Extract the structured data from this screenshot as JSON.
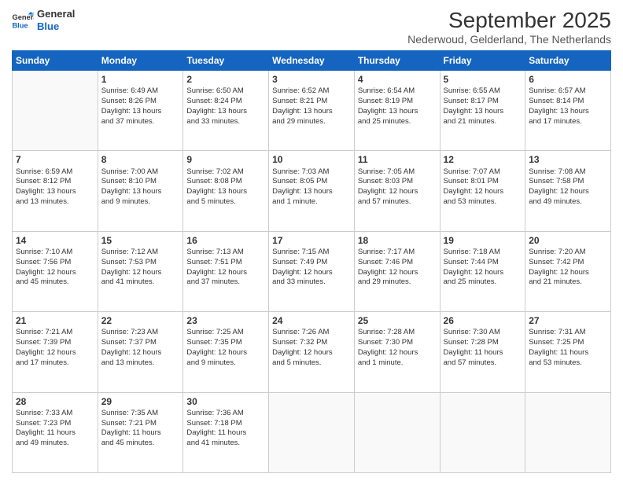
{
  "logo": {
    "line1": "General",
    "line2": "Blue"
  },
  "title": "September 2025",
  "subtitle": "Nederwoud, Gelderland, The Netherlands",
  "headers": [
    "Sunday",
    "Monday",
    "Tuesday",
    "Wednesday",
    "Thursday",
    "Friday",
    "Saturday"
  ],
  "weeks": [
    [
      {
        "day": "",
        "info": ""
      },
      {
        "day": "1",
        "info": "Sunrise: 6:49 AM\nSunset: 8:26 PM\nDaylight: 13 hours\nand 37 minutes."
      },
      {
        "day": "2",
        "info": "Sunrise: 6:50 AM\nSunset: 8:24 PM\nDaylight: 13 hours\nand 33 minutes."
      },
      {
        "day": "3",
        "info": "Sunrise: 6:52 AM\nSunset: 8:21 PM\nDaylight: 13 hours\nand 29 minutes."
      },
      {
        "day": "4",
        "info": "Sunrise: 6:54 AM\nSunset: 8:19 PM\nDaylight: 13 hours\nand 25 minutes."
      },
      {
        "day": "5",
        "info": "Sunrise: 6:55 AM\nSunset: 8:17 PM\nDaylight: 13 hours\nand 21 minutes."
      },
      {
        "day": "6",
        "info": "Sunrise: 6:57 AM\nSunset: 8:14 PM\nDaylight: 13 hours\nand 17 minutes."
      }
    ],
    [
      {
        "day": "7",
        "info": "Sunrise: 6:59 AM\nSunset: 8:12 PM\nDaylight: 13 hours\nand 13 minutes."
      },
      {
        "day": "8",
        "info": "Sunrise: 7:00 AM\nSunset: 8:10 PM\nDaylight: 13 hours\nand 9 minutes."
      },
      {
        "day": "9",
        "info": "Sunrise: 7:02 AM\nSunset: 8:08 PM\nDaylight: 13 hours\nand 5 minutes."
      },
      {
        "day": "10",
        "info": "Sunrise: 7:03 AM\nSunset: 8:05 PM\nDaylight: 13 hours\nand 1 minute."
      },
      {
        "day": "11",
        "info": "Sunrise: 7:05 AM\nSunset: 8:03 PM\nDaylight: 12 hours\nand 57 minutes."
      },
      {
        "day": "12",
        "info": "Sunrise: 7:07 AM\nSunset: 8:01 PM\nDaylight: 12 hours\nand 53 minutes."
      },
      {
        "day": "13",
        "info": "Sunrise: 7:08 AM\nSunset: 7:58 PM\nDaylight: 12 hours\nand 49 minutes."
      }
    ],
    [
      {
        "day": "14",
        "info": "Sunrise: 7:10 AM\nSunset: 7:56 PM\nDaylight: 12 hours\nand 45 minutes."
      },
      {
        "day": "15",
        "info": "Sunrise: 7:12 AM\nSunset: 7:53 PM\nDaylight: 12 hours\nand 41 minutes."
      },
      {
        "day": "16",
        "info": "Sunrise: 7:13 AM\nSunset: 7:51 PM\nDaylight: 12 hours\nand 37 minutes."
      },
      {
        "day": "17",
        "info": "Sunrise: 7:15 AM\nSunset: 7:49 PM\nDaylight: 12 hours\nand 33 minutes."
      },
      {
        "day": "18",
        "info": "Sunrise: 7:17 AM\nSunset: 7:46 PM\nDaylight: 12 hours\nand 29 minutes."
      },
      {
        "day": "19",
        "info": "Sunrise: 7:18 AM\nSunset: 7:44 PM\nDaylight: 12 hours\nand 25 minutes."
      },
      {
        "day": "20",
        "info": "Sunrise: 7:20 AM\nSunset: 7:42 PM\nDaylight: 12 hours\nand 21 minutes."
      }
    ],
    [
      {
        "day": "21",
        "info": "Sunrise: 7:21 AM\nSunset: 7:39 PM\nDaylight: 12 hours\nand 17 minutes."
      },
      {
        "day": "22",
        "info": "Sunrise: 7:23 AM\nSunset: 7:37 PM\nDaylight: 12 hours\nand 13 minutes."
      },
      {
        "day": "23",
        "info": "Sunrise: 7:25 AM\nSunset: 7:35 PM\nDaylight: 12 hours\nand 9 minutes."
      },
      {
        "day": "24",
        "info": "Sunrise: 7:26 AM\nSunset: 7:32 PM\nDaylight: 12 hours\nand 5 minutes."
      },
      {
        "day": "25",
        "info": "Sunrise: 7:28 AM\nSunset: 7:30 PM\nDaylight: 12 hours\nand 1 minute."
      },
      {
        "day": "26",
        "info": "Sunrise: 7:30 AM\nSunset: 7:28 PM\nDaylight: 11 hours\nand 57 minutes."
      },
      {
        "day": "27",
        "info": "Sunrise: 7:31 AM\nSunset: 7:25 PM\nDaylight: 11 hours\nand 53 minutes."
      }
    ],
    [
      {
        "day": "28",
        "info": "Sunrise: 7:33 AM\nSunset: 7:23 PM\nDaylight: 11 hours\nand 49 minutes."
      },
      {
        "day": "29",
        "info": "Sunrise: 7:35 AM\nSunset: 7:21 PM\nDaylight: 11 hours\nand 45 minutes."
      },
      {
        "day": "30",
        "info": "Sunrise: 7:36 AM\nSunset: 7:18 PM\nDaylight: 11 hours\nand 41 minutes."
      },
      {
        "day": "",
        "info": ""
      },
      {
        "day": "",
        "info": ""
      },
      {
        "day": "",
        "info": ""
      },
      {
        "day": "",
        "info": ""
      }
    ]
  ]
}
